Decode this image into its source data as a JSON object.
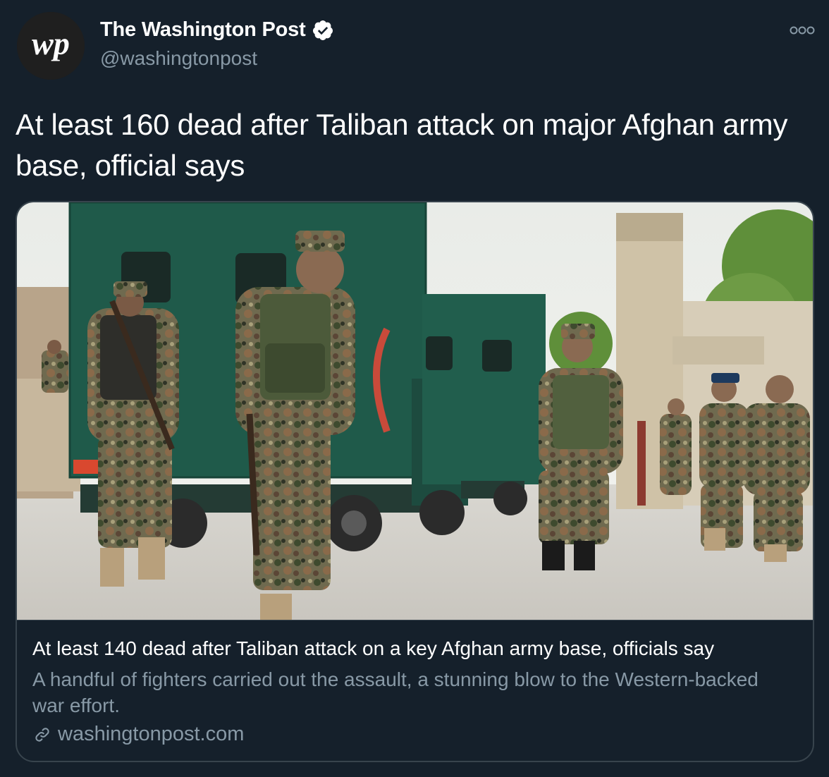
{
  "author": {
    "display_name": "The Washington Post",
    "handle": "@washingtonpost",
    "avatar_icon": "wp-logo",
    "verified_icon": "verified-badge-icon"
  },
  "menu": {
    "icon": "more-options-icon"
  },
  "tweet": {
    "text": "At least 160 dead after Taliban attack on major Afghan army base, official says"
  },
  "card": {
    "image_description_icon": "news-photo",
    "title": "At least 140 dead after Taliban attack on a key Afghan army base, officials say",
    "description": "A handful of fighters carried out the assault, a stunning blow to the Western-backed war effort.",
    "domain": "washingtonpost.com",
    "link_icon": "link-icon"
  },
  "colors": {
    "background": "#15202b",
    "border": "#38444d",
    "secondary_text": "#8899a6",
    "primary_text": "#ffffff"
  }
}
